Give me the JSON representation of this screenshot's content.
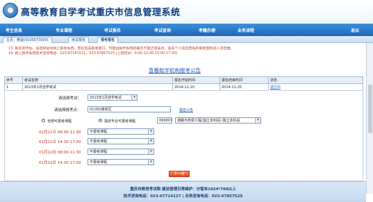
{
  "header": {
    "site_title": "高等教育自学考试重庆市信息管理系统"
  },
  "nav": {
    "items": [
      {
        "label": "考生信息"
      },
      {
        "label": "专业课程"
      },
      {
        "label": "考试报名"
      },
      {
        "label": "考试查询"
      },
      {
        "label": "考籍办理"
      },
      {
        "label": "业务流程"
      }
    ],
    "exit_label": "退出"
  },
  "subnav": {
    "tabs": [
      {
        "label": "主页：黄益(0100073000)"
      },
      {
        "label": "考试报名"
      },
      {
        "label": "报考报名"
      }
    ]
  },
  "notice": {
    "lines": [
      "13. 报名完毕后，请选择退出网上报考系统，若在有关报考窗口，可能因操作系统的差异不能正常关闭，需关个人信息查看的或者重新进入浏览器。",
      "14. 网上报考系统技术咨询电话：023-67181511，023-67857525 (上班时间：9:00-12:00,13:00-17:30)"
    ]
  },
  "announcement_link": "查看助学机构报考公告",
  "schedule_table": {
    "headers": [
      "序号",
      "考试名称",
      "报名开始时间",
      "报名结束时间",
      "状态"
    ],
    "rows": [
      [
        "1",
        "2013年1月自学考试",
        "2014-11-10",
        "2014-11-25",
        "进行中"
      ]
    ]
  },
  "form": {
    "exam_label": "请选择考试：",
    "exam_value": "2013年1月自学考试",
    "location_label": "请选择报考点：",
    "location_value": "01(00)南岸区",
    "location_link": "报名公告",
    "radio_all_label": "全部可报考课程",
    "radio_major_label": "指定专业可报考课程",
    "major_code": "090807",
    "major_name": "通路与桥梁工程(独立本科段) 独立本科段",
    "slots": [
      {
        "time": "01月11日 08:00-11:30",
        "value": "不报考课程"
      },
      {
        "time": "01月11日 14:30-17:00",
        "value": "不报考课程"
      },
      {
        "time": "01月12日 08:00-11:30",
        "value": "不报考课程"
      },
      {
        "time": "01月12日 14:30-17:00",
        "value": "不报考课程"
      }
    ],
    "next_button": "下一步"
  },
  "footer": {
    "line1": "重庆市教育考试院    建设管理日常维护：分管本1024*768以上",
    "line2": "技术咨询电话：023-67714127       |       业务咨询电话：023-67857525"
  }
}
